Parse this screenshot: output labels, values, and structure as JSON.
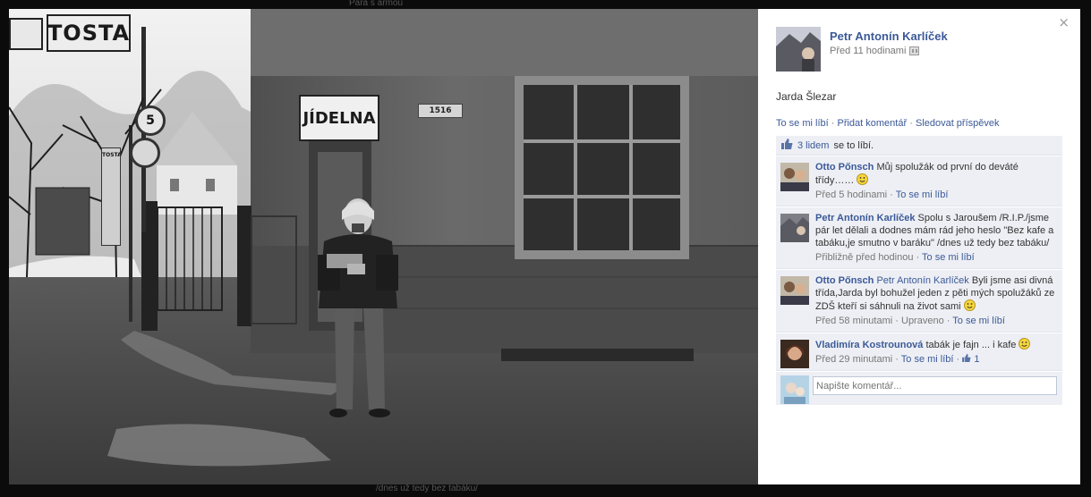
{
  "backdrop": {
    "top_text": "Pára s armou",
    "bottom_text": "/dnes už tedy bez tabáku/"
  },
  "photo": {
    "sign_tosta": "TOSTA",
    "sign_jidelna": "JÍDELNA",
    "house_number": "1516",
    "speed_sign": "5",
    "small_sign": "TOSTA"
  },
  "sidebar": {
    "close_glyph": "×",
    "owner_name": "Petr Antonín Karlíček",
    "owner_time": "Před 11 hodinami",
    "caption": "Jarda Šlezar",
    "actions": {
      "like": "To se mi líbí",
      "comment": "Přidat komentář",
      "follow": "Sledovat příspěvek",
      "separator": "·"
    },
    "likes": {
      "count_link": "3 lidem",
      "suffix": "se to líbí."
    },
    "comments": [
      {
        "name": "Otto Pőnsch",
        "mention": "",
        "text": "Můj spolužák od první do deváté třídy……",
        "smiley": true,
        "time": "Před 5 hodinami",
        "edited": "",
        "like_label": "To se mi líbí",
        "like_count": ""
      },
      {
        "name": "Petr Antonín Karlíček",
        "mention": "",
        "text": "Spolu s Jaroušem /R.I.P./jsme pár let dělali a dodnes mám rád jeho heslo \"Bez kafe a tabáku,je smutno v baráku\" /dnes už tedy bez tabáku/",
        "smiley": false,
        "time": "Přibližně před hodinou",
        "edited": "",
        "like_label": "To se mi líbí",
        "like_count": ""
      },
      {
        "name": "Otto Pőnsch",
        "mention": "Petr Antonín Karlíček",
        "text": "Byli jsme asi divná třída,Jarda byl bohužel jeden z pěti mých spolužáků ze ZDŠ kteří si sáhnuli na život sami",
        "smiley": true,
        "time": "Před 58 minutami",
        "edited": "Upraveno",
        "like_label": "To se mi líbí",
        "like_count": ""
      },
      {
        "name": "Vladimíra Kostrounová",
        "mention": "",
        "text": "tabák je fajn ... i kafe",
        "smiley": true,
        "time": "Před 29 minutami",
        "edited": "",
        "like_label": "To se mi líbí",
        "like_count": "1"
      }
    ],
    "comment_placeholder": "Napište komentář..."
  },
  "colors": {
    "link": "#3b5998",
    "comments_bg": "#edeff4",
    "backdrop": "#0b0b0b"
  }
}
